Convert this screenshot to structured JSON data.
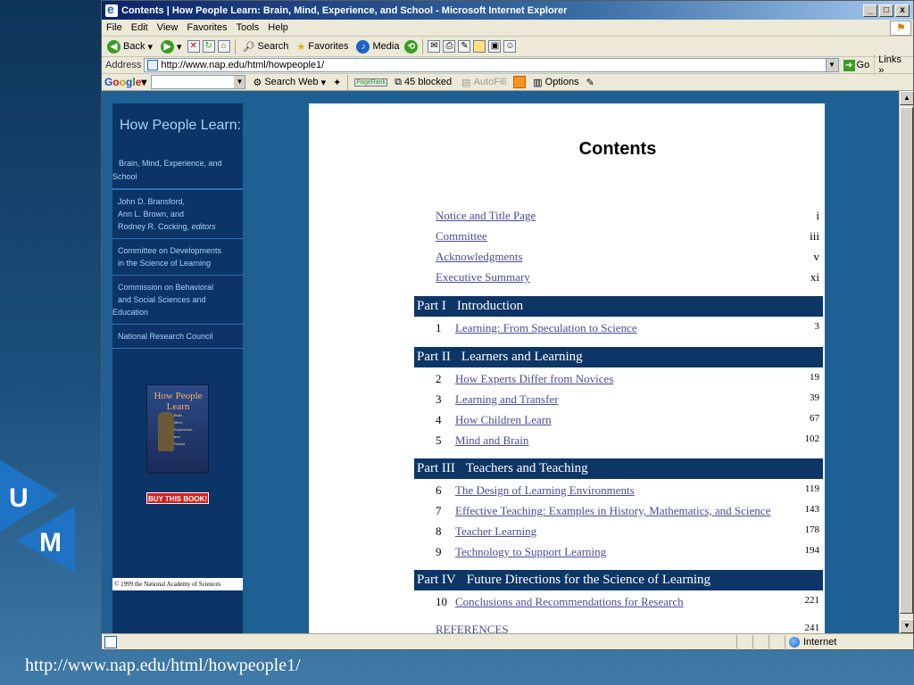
{
  "browser": {
    "title": "Contents | How People Learn: Brain, Mind, Experience, and School - Microsoft Internet Explorer",
    "window_buttons": [
      "_",
      "□",
      "x"
    ],
    "menu": [
      "File",
      "Edit",
      "View",
      "Favorites",
      "Tools",
      "Help"
    ],
    "toolbar": {
      "back": "Back",
      "search": "Search",
      "favorites": "Favorites",
      "media": "Media"
    },
    "address_label": "Address",
    "url": "http://www.nap.edu/html/howpeople1/",
    "go_label": "Go",
    "links_label": "Links",
    "google": {
      "search_web": "Search Web",
      "blocked": "45 blocked",
      "autofill": "AutoFill",
      "options": "Options",
      "pagerank": "PageRank"
    },
    "status_zone": "Internet"
  },
  "sidebar": {
    "title": "How People Learn:",
    "subtitle_line1": "Brain, Mind, Experience, and",
    "subtitle_line2": "School",
    "editors": [
      "John D. Bransford,",
      "Ann L. Brown, and",
      "Rodney R. Cocking,"
    ],
    "editors_role": "editors",
    "committee": [
      "Committee on Developments",
      "in the Science of Learning"
    ],
    "commission_line1": "Commission on Behavioral",
    "commission_line2": "and Social Sciences and",
    "commission_line3": "Education",
    "council": "National Research Council",
    "book_title": "How People Learn",
    "book_sub": [
      "Brain,",
      "Mind,",
      "Experience,",
      "and",
      "School"
    ],
    "buy_button": "BUY THIS BOOK!",
    "copyright": "© 1999 the National Academy of Sciences"
  },
  "contents": {
    "title": "Contents",
    "front_matter": [
      {
        "label": "Notice and Title Page",
        "page": "i"
      },
      {
        "label": "Committee",
        "page": "iii"
      },
      {
        "label": "Acknowledgments",
        "page": "v"
      },
      {
        "label": "Executive Summary",
        "page": "xi"
      }
    ],
    "parts": [
      {
        "label": "Part I",
        "title": "Introduction",
        "chapters": [
          {
            "num": "1",
            "title": "Learning: From Speculation to Science",
            "page": "3"
          }
        ]
      },
      {
        "label": "Part II",
        "title": "Learners and Learning",
        "chapters": [
          {
            "num": "2",
            "title": "How Experts Differ from Novices",
            "page": "19"
          },
          {
            "num": "3",
            "title": "Learning and Transfer",
            "page": "39"
          },
          {
            "num": "4",
            "title": "How Children Learn",
            "page": "67"
          },
          {
            "num": "5",
            "title": "Mind and Brain",
            "page": "102"
          }
        ]
      },
      {
        "label": "Part III",
        "title": "Teachers and Teaching",
        "chapters": [
          {
            "num": "6",
            "title": "The Design of Learning Environments",
            "page": "119"
          },
          {
            "num": "7",
            "title": "Effective Teaching: Examples in History, Mathematics, and Science",
            "page": "143"
          },
          {
            "num": "8",
            "title": "Teacher Learning",
            "page": "178"
          },
          {
            "num": "9",
            "title": "Technology to Support Learning",
            "page": "194"
          }
        ]
      },
      {
        "label": "Part IV",
        "title": "Future Directions for the Science of Learning",
        "chapters": [
          {
            "num": "10",
            "title": "Conclusions and Recommendations for Research",
            "page": "221"
          }
        ]
      }
    ],
    "references": {
      "label": "REFERENCES",
      "page": "241"
    }
  },
  "slide": {
    "logo_letters": [
      "U",
      "M"
    ],
    "url_caption": "http://www.nap.edu/html/howpeople1/"
  }
}
